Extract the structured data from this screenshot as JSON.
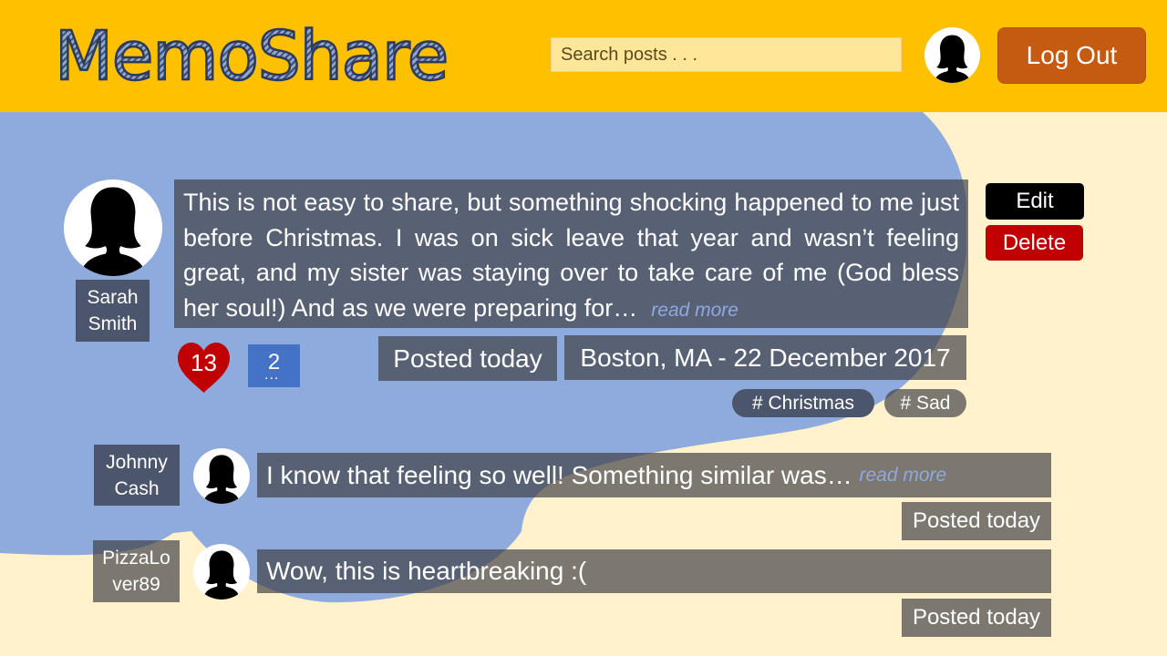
{
  "app": {
    "name": "MemoShare"
  },
  "header": {
    "search_placeholder": "Search posts . . .",
    "logout_label": "Log Out"
  },
  "post": {
    "author": "Sarah Smith",
    "author_line1": "Sarah",
    "author_line2": "Smith",
    "text": "This is not easy to share, but something shocking happened to me just before Christmas. I was on sick leave that year and wasn’t feeling great, and my sister was staying over to take care of me (God bless her soul!) And as we were preparing for…",
    "read_more": "read more",
    "edit_label": "Edit",
    "delete_label": "Delete",
    "likes": "13",
    "comments_count": "2",
    "comments_icon_dots": "...",
    "posted": "Posted today",
    "location_date": "Boston, MA - 22 December 2017",
    "tags": [
      "# Christmas",
      "# Sad"
    ]
  },
  "comments": [
    {
      "author_line1": "Johnny",
      "author_line2": "Cash",
      "text": "I know that feeling so well! Something similar was…",
      "read_more": "read more",
      "posted": "Posted today"
    },
    {
      "author_line1": "PizzaLo",
      "author_line2": "ver89",
      "text": "Wow, this is heartbreaking :(",
      "posted": "Posted today"
    }
  ],
  "colors": {
    "header_bg": "#ffc000",
    "page_bg": "#fff2cc",
    "cloud": "#8faadc",
    "logout": "#c55a11",
    "delete": "#c00000",
    "heart": "#c00000",
    "comment_button": "#4472c4"
  },
  "icons": {
    "user_avatar": "person-silhouette-icon",
    "likes": "heart-icon",
    "comments": "comment-icon"
  }
}
